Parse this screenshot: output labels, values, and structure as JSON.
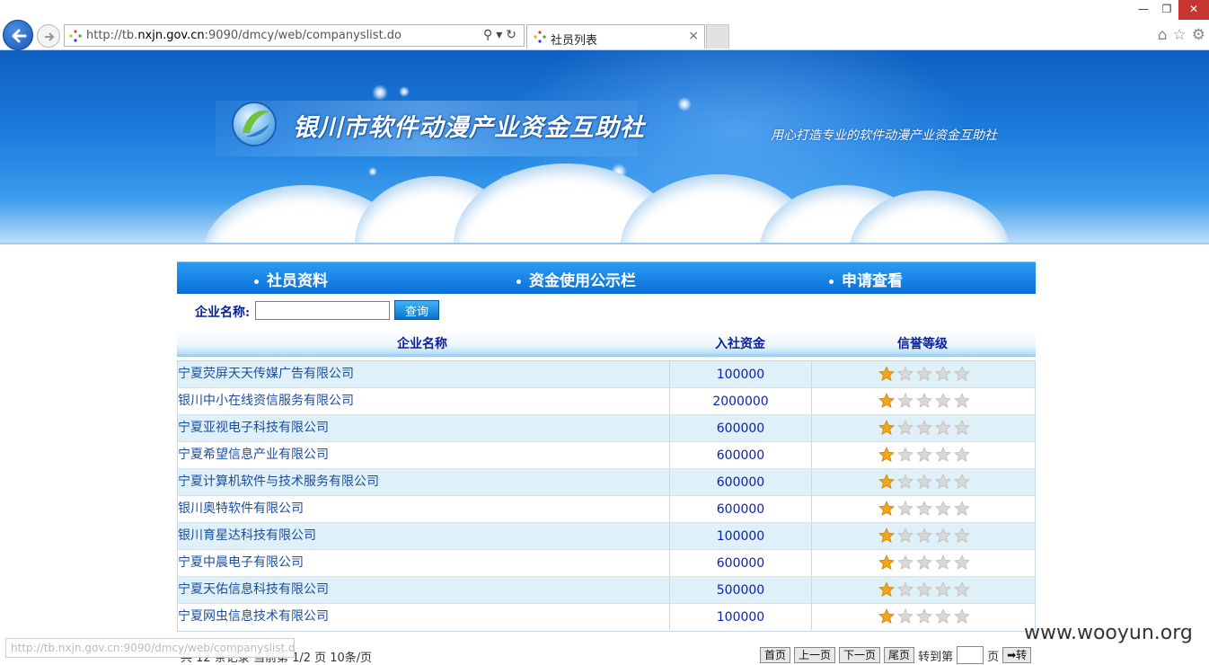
{
  "browser": {
    "url_prefix": "http://tb.",
    "url_domain": "nxjn.gov.cn",
    "url_suffix": ":9090/dmcy/web/companyslist.do",
    "tab_title": "社员列表",
    "close_tab": "×",
    "status_url": "http://tb.nxjn.gov.cn:9090/dmcy/web/companyslist.do"
  },
  "banner": {
    "org_name": "银川市软件动漫产业资金互助社",
    "slogan": "用心打造专业的软件动漫产业资金互助社"
  },
  "nav": {
    "items": [
      {
        "label": "社员资料"
      },
      {
        "label": "资金使用公示栏"
      },
      {
        "label": "申请查看"
      }
    ]
  },
  "search": {
    "label": "企业名称:",
    "value": "",
    "button": "查询"
  },
  "table": {
    "headers": [
      "企业名称",
      "入社资金",
      "信誉等级"
    ],
    "rows": [
      {
        "name": "宁夏荧屏天天传媒广告有限公司",
        "capital": "100000",
        "rating": 1
      },
      {
        "name": "银川中小在线资信服务有限公司",
        "capital": "2000000",
        "rating": 1
      },
      {
        "name": "宁夏亚视电子科技有限公司",
        "capital": "600000",
        "rating": 1
      },
      {
        "name": "宁夏希望信息产业有限公司",
        "capital": "600000",
        "rating": 1
      },
      {
        "name": "宁夏计算机软件与技术服务有限公司",
        "capital": "600000",
        "rating": 1
      },
      {
        "name": "银川奥特软件有限公司",
        "capital": "600000",
        "rating": 1
      },
      {
        "name": "银川育星达科技有限公司",
        "capital": "100000",
        "rating": 1
      },
      {
        "name": "宁夏中晨电子有限公司",
        "capital": "600000",
        "rating": 1
      },
      {
        "name": "宁夏天佑信息科技有限公司",
        "capital": "500000",
        "rating": 1
      },
      {
        "name": "宁夏网虫信息技术有限公司",
        "capital": "100000",
        "rating": 1
      }
    ],
    "max_rating": 5
  },
  "pagination": {
    "info": "共 12 条记录   当前第 1/2 页   10条/页",
    "first": "首页",
    "prev": "上一页",
    "next": "下一页",
    "last": "尾页",
    "goto_label": "转到第",
    "page_unit": "页",
    "goto_button": "➡转"
  },
  "watermark": "www.wooyun.org",
  "colors": {
    "accent": "#0a6fd8",
    "star_filled": "#f2a516",
    "star_empty": "#d8d8d8"
  }
}
